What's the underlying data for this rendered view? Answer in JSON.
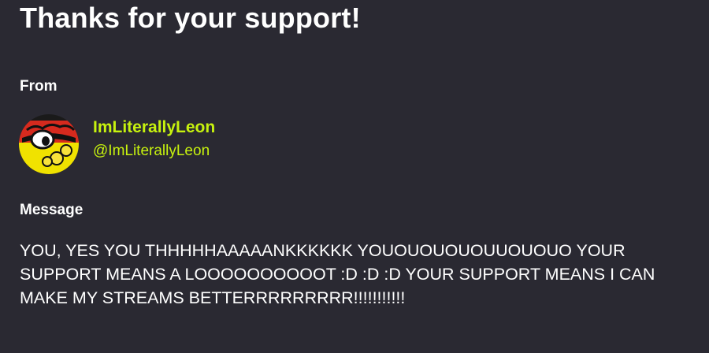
{
  "page": {
    "title": "Thanks for your support!"
  },
  "from": {
    "label": "From",
    "display_name": "ImLiterallyLeon",
    "handle": "@ImLiterallyLeon",
    "avatar_icon": "avatar-icon"
  },
  "message": {
    "label": "Message",
    "text": "YOU, YES YOU THHHHHAAAAANKKKKKK YOUOUOUOUOUUOUOUO YOUR SUPPORT MEANS A LOOOOOOOOOOT :D :D :D YOUR SUPPORT MEANS I CAN MAKE MY STREAMS BETTERRRRRRRRR!!!!!!!!!!!"
  },
  "colors": {
    "background": "#2a2932",
    "accent": "#c7f20e",
    "text": "#ffffff"
  }
}
